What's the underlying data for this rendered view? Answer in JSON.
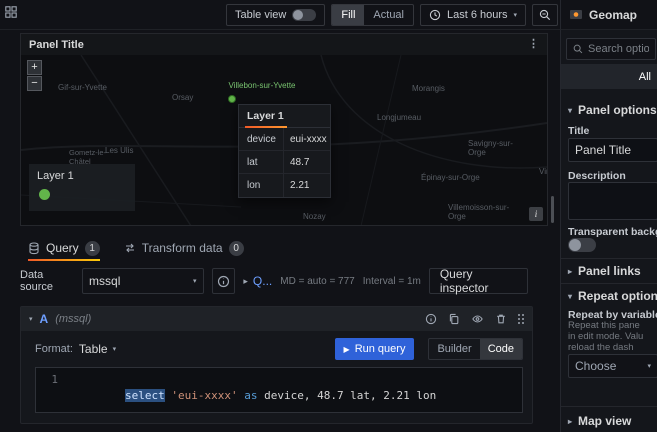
{
  "topbar": {
    "table_view": "Table view",
    "fill": "Fill",
    "actual": "Actual",
    "time_range": "Last 6 hours"
  },
  "panel": {
    "title": "Panel Title",
    "zoom": {
      "plus": "+",
      "minus": "−"
    },
    "legend_title": "Layer 1",
    "attribution": "i",
    "tooltip": {
      "title": "Layer 1",
      "rows": [
        {
          "key": "device",
          "value": "eui-xxxx"
        },
        {
          "key": "lat",
          "value": "48.7"
        },
        {
          "key": "lon",
          "value": "2.21"
        }
      ]
    },
    "labels": [
      {
        "text": "Gif-sur-Yvette"
      },
      {
        "text": "Orsay"
      },
      {
        "text": "Villebon-sur-Yvette"
      },
      {
        "text": "Morangis"
      },
      {
        "text": "Longjumeau"
      },
      {
        "text": "Les Ulis"
      },
      {
        "text": "Gometz-le-Châtel"
      },
      {
        "text": "Savigny-sur-Orge"
      },
      {
        "text": "Épinay-sur-Orge"
      },
      {
        "text": "Villemoisson-sur-Orge"
      },
      {
        "text": "Nozay"
      },
      {
        "text": "Viry"
      }
    ]
  },
  "tabs": {
    "query": "Query",
    "query_count": "1",
    "transform": "Transform data",
    "transform_count": "0"
  },
  "query_toolbar": {
    "datasource_label": "Data source",
    "datasource_value": "mssql",
    "options_abbrev": "Q...",
    "max_data": "MD = auto = 777",
    "interval": "Interval = 1m",
    "inspector": "Query inspector"
  },
  "query": {
    "ref": "A",
    "ds_hint": "(mssql)",
    "format_label": "Format:",
    "format_value": "Table",
    "run": "Run query",
    "builder": "Builder",
    "code": "Code",
    "line": "1",
    "sql_kw1": "select",
    "sql_str": " 'eui-xxxx' ",
    "sql_kw2": "as",
    "sql_rest": " device, 48.7 lat, 2.21 lon"
  },
  "sidebar": {
    "title": "Geomap",
    "search_placeholder": "Search options",
    "filter_all": "All",
    "panel_options_title": "Panel options",
    "title_label": "Title",
    "title_value": "Panel Title",
    "description_label": "Description",
    "transparent_label": "Transparent background",
    "panel_links_title": "Panel links",
    "repeat_title": "Repeat options",
    "repeat_label": "Repeat by variable",
    "repeat_desc_1": "Repeat this pane",
    "repeat_desc_2": "in edit mode. Valu",
    "repeat_desc_3": "reload the dash",
    "choose_placeholder": "Choose",
    "map_view_title": "Map view"
  },
  "colors": {
    "accent_orange": "#ff780a",
    "run_blue": "#2f62d9",
    "marker_green": "#62b54a",
    "ref_blue": "#6e9fff"
  }
}
